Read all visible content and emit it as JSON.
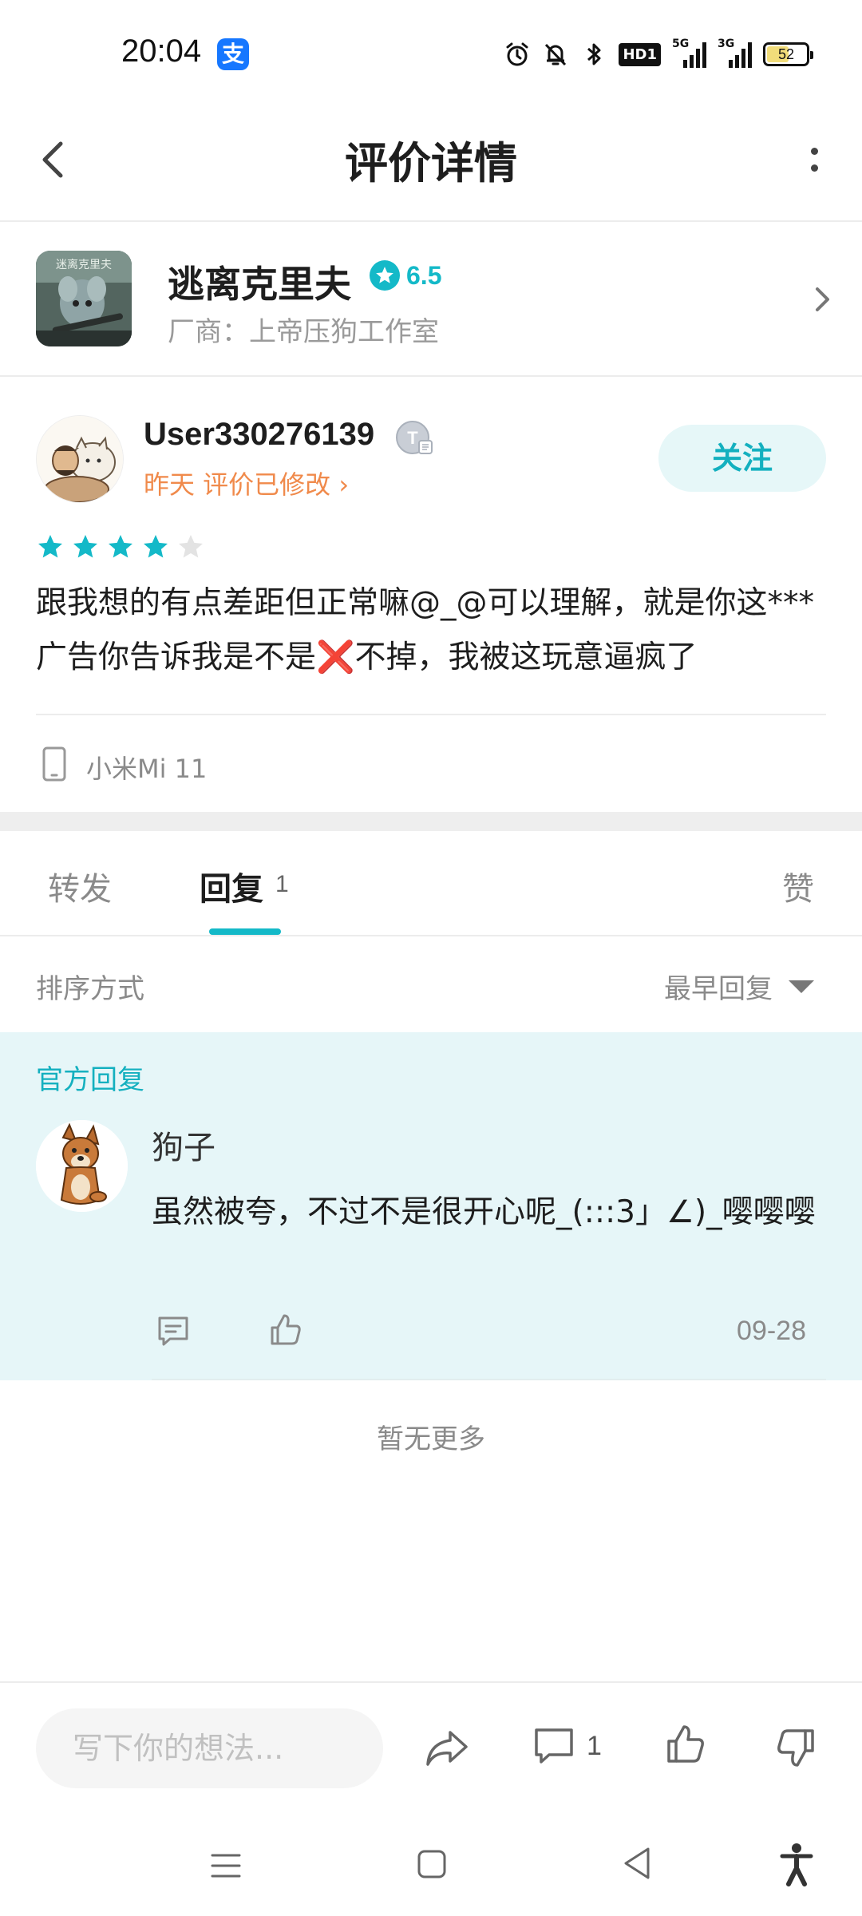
{
  "status_bar": {
    "time": "20:04",
    "app_icon": "alipay-icon",
    "app_icon_glyph": "支",
    "hd_label": "HD1",
    "signal1_label": "5G",
    "signal2_label": "3G",
    "battery": "52",
    "icons": [
      "alarm-icon",
      "mute-bell-icon",
      "bluetooth-icon",
      "hd-icon",
      "signal-5g-icon",
      "signal-3g-icon",
      "battery-icon"
    ]
  },
  "header": {
    "title": "评价详情"
  },
  "game": {
    "name": "逃离克里夫",
    "rating": "6.5",
    "vendor": "厂商：上帝压狗工作室",
    "thumb_text": "迷离克里夫"
  },
  "review": {
    "username": "User330276139",
    "badge_letter": "T",
    "meta": "昨天 评价已修改",
    "follow_label": "关注",
    "stars_filled": 4,
    "stars_total": 5,
    "text": "跟我想的有点差距但正常嘛@_@可以理解，就是你这***广告你告诉我是不是❌不掉，我被这玩意逼疯了",
    "device": "小米Mi 11"
  },
  "tabs": {
    "forward": "转发",
    "reply": "回复",
    "reply_count": "1",
    "like": "赞"
  },
  "sort": {
    "label": "排序方式",
    "selected": "最早回复"
  },
  "official_reply": {
    "label": "官方回复",
    "author": "狗子",
    "text": "虽然被夸，不过不是很开心呢_(:::3」∠)_嘤嘤嘤",
    "date": "09-28"
  },
  "no_more": "暂无更多",
  "action_bar": {
    "input_placeholder": "写下你的想法...",
    "comment_count": "1"
  },
  "colors": {
    "accent": "#14b9c8",
    "orange": "#f08a4b",
    "official_bg": "#e6f6f8"
  }
}
